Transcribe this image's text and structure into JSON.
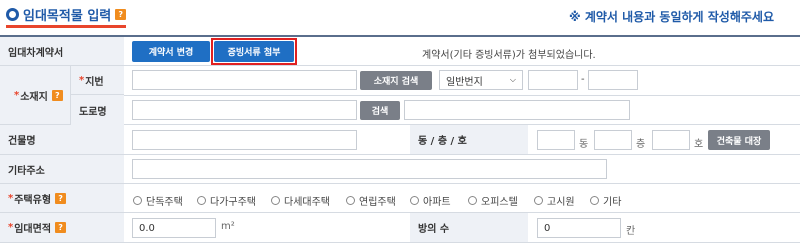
{
  "header": {
    "title": "임대목적물 입력",
    "help": "?",
    "notice": "※ 계약서 내용과 동일하게 작성해주세요"
  },
  "contract": {
    "label": "임대차계약서",
    "change_button": "계약서 변경",
    "attach_button": "증빙서류 첨부",
    "status": "계약서(기타 증빙서류)가 첨부되었습니다."
  },
  "location": {
    "label": "소재지",
    "help": "?",
    "lot_label": "지번",
    "lot_search_button": "소재지 검색",
    "lot_type_selected": "일반번지",
    "dash": "-",
    "road_label": "도로명",
    "road_search_button": "검색"
  },
  "building": {
    "label": "건물명",
    "dong_floor_ho_label": "동 / 층 / 호",
    "dong_unit": "동",
    "floor_unit": "층",
    "ho_unit": "호",
    "ledger_button": "건축물 대장"
  },
  "other_address": {
    "label": "기타주소"
  },
  "housing_type": {
    "label": "주택유형",
    "help": "?",
    "options": [
      "단독주택",
      "다가구주택",
      "다세대주택",
      "연립주택",
      "아파트",
      "오피스텔",
      "고시원",
      "기타"
    ]
  },
  "area": {
    "label": "임대면적",
    "help": "?",
    "value": "0.0",
    "unit": "m²",
    "rooms_label": "방의 수",
    "rooms_value": "0",
    "rooms_unit": "칸"
  },
  "colors": {
    "accent_blue": "#1f5aa8",
    "button_blue": "#1f6fc4",
    "highlight_red": "#e02020",
    "help_orange": "#f08c1e"
  }
}
